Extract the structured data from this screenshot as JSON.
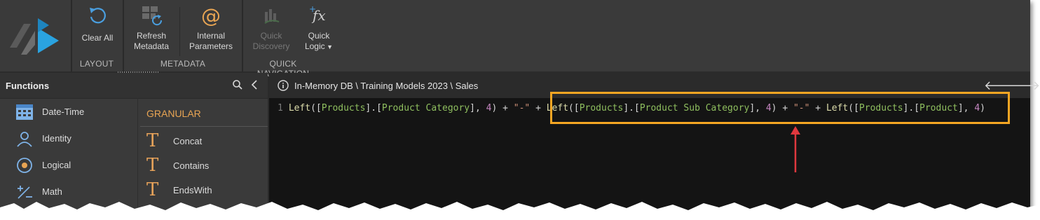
{
  "ribbon": {
    "buttons": [
      {
        "label": "Clear All",
        "icon": "undo-icon"
      },
      {
        "label": "Refresh\nMetadata",
        "icon": "refresh-metadata-icon"
      },
      {
        "label": "Internal\nParameters",
        "icon": "at-sign-icon"
      },
      {
        "label": "Quick\nDiscovery",
        "icon": "quick-discovery-icon",
        "disabled": true
      },
      {
        "label": "Quick\nLogic",
        "icon": "fx-icon",
        "dropdown": true
      }
    ],
    "groups": {
      "layout": "LAYOUT",
      "metadata": "METADATA",
      "quick_navigation": "QUICK NAVIGATION"
    }
  },
  "functions_panel": {
    "title": "Functions",
    "categories": [
      {
        "label": "Date-Time",
        "icon": "calendar-icon"
      },
      {
        "label": "Identity",
        "icon": "person-icon"
      },
      {
        "label": "Logical",
        "icon": "radio-icon"
      },
      {
        "label": "Math",
        "icon": "math-plus-minus-icon"
      }
    ],
    "group_heading": "GRANULAR",
    "functions": [
      "Concat",
      "Contains",
      "EndsWith"
    ]
  },
  "editor": {
    "path": "In-Memory DB \\ Training Models 2023 \\ Sales",
    "line_number": "1"
  },
  "colors": {
    "highlight_box": "#f5a623",
    "arrow": "#e0383e",
    "accent_text": "#e9a553"
  }
}
